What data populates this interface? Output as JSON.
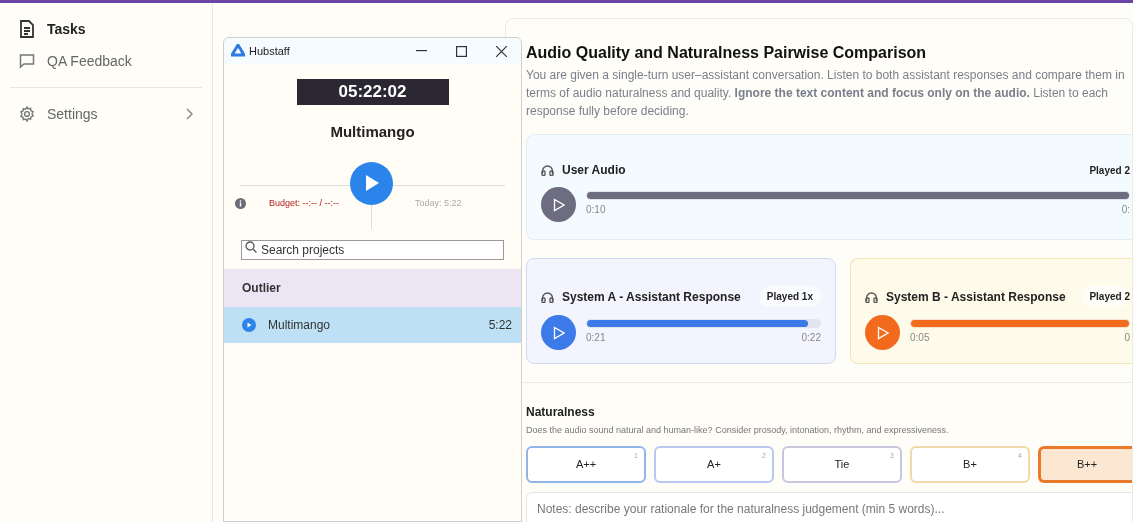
{
  "sidebar": {
    "items": [
      {
        "label": "Tasks",
        "selected": true
      },
      {
        "label": "QA Feedback",
        "selected": false
      },
      {
        "label": "Settings",
        "selected": false
      }
    ]
  },
  "hubstaff": {
    "title": "Hubstaff",
    "timer": "05:22:02",
    "project": "Multimango",
    "budget": "Budget: --:-- / --:--",
    "today": "Today: 5:22",
    "search": {
      "placeholder": "Search projects"
    },
    "group": "Outlier",
    "projects": [
      {
        "name": "Multimango",
        "time": "5:22",
        "selected": true
      }
    ]
  },
  "task": {
    "title": "Audio Quality and Naturalness Pairwise Comparison",
    "description": "You are given a single-turn user–assistant conversation. Listen to both assistant responses and compare them in terms of audio naturalness and quality. **Ignore the text content and focus only on the audio.** Listen to each response fully before deciding.",
    "user_audio": {
      "label": "User Audio",
      "played": "Played 2",
      "current": "0:10",
      "end": "0:",
      "level": 1
    },
    "systems": [
      {
        "label": "System A - Assistant Response",
        "played": "Played 1x",
        "current": "0:21",
        "end": "0:22",
        "level": 0.95,
        "color": "#3b7ae8"
      },
      {
        "label": "System B - Assistant Response",
        "played": "Played 2",
        "current": "0:05",
        "end": "0",
        "level": 1,
        "color": "#f26b1d"
      }
    ],
    "naturalness": {
      "title": "Naturalness",
      "hint": "Does the audio sound natural and human-like? Consider prosody, intonation, rhythm, and expressiveness.",
      "options": [
        {
          "label": "A++",
          "key": "1",
          "selected": false,
          "color": "#93b4e8"
        },
        {
          "label": "A+",
          "key": "2",
          "selected": false,
          "color": "#b9c8ee"
        },
        {
          "label": "Tie",
          "key": "3",
          "selected": false,
          "color": "#c9c6e0"
        },
        {
          "label": "B+",
          "key": "4",
          "selected": false,
          "color": "#f1d9a8"
        },
        {
          "label": "B++",
          "selected": true,
          "color": "#ea7a2a"
        }
      ],
      "notes": {
        "placeholder": "Notes: describe your rationale for the naturalness judgement (min 5 words)..."
      }
    }
  }
}
